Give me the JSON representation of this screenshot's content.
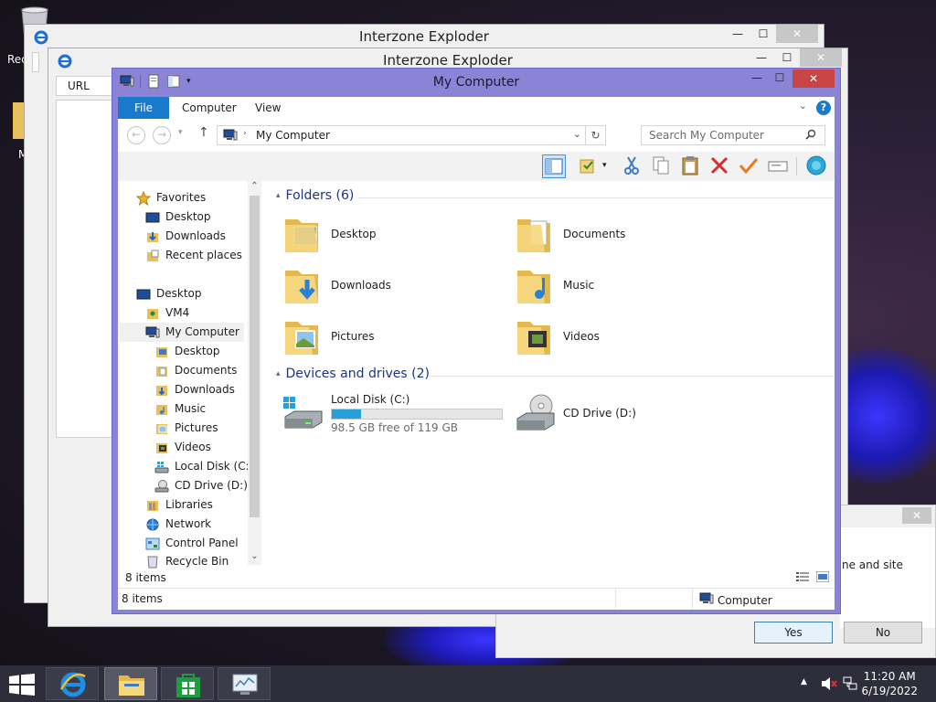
{
  "desktop": {
    "recycle_label_partial": "Rec",
    "my_label_partial": "M"
  },
  "ie_back": {
    "title": "Interzone Exploder"
  },
  "ie_front": {
    "title": "Interzone Exploder",
    "url_label": "URL"
  },
  "explorer": {
    "title": "My Computer",
    "tabs": [
      "File",
      "Computer",
      "View"
    ],
    "address": "My Computer",
    "search_placeholder": "Search My Computer",
    "nav": {
      "favorites": "Favorites",
      "fav_items": [
        "Desktop",
        "Downloads",
        "Recent places"
      ],
      "desktop": "Desktop",
      "vm": "VM4",
      "my_computer": "My Computer",
      "mc_items": [
        "Desktop",
        "Documents",
        "Downloads",
        "Music",
        "Pictures",
        "Videos",
        "Local Disk (C:)",
        "CD Drive (D:)"
      ],
      "libraries": "Libraries",
      "network": "Network",
      "control_panel": "Control Panel",
      "recycle_bin": "Recycle Bin"
    },
    "folders_header": "Folders (6)",
    "folders": [
      "Desktop",
      "Documents",
      "Downloads",
      "Music",
      "Pictures",
      "Videos"
    ],
    "devices_header": "Devices and drives (2)",
    "local_disk": {
      "name": "Local Disk (C:)",
      "free_text": "98.5 GB free of 119 GB",
      "used_fraction": 0.17
    },
    "cd_drive": "CD Drive (D:)",
    "inner_status": "8 items",
    "status_left": "8 items",
    "status_right": "Computer"
  },
  "dialog": {
    "partial_text": "ne and site",
    "yes": "Yes",
    "no": "No"
  },
  "taskbar": {
    "time": "11:20 AM",
    "date": "6/19/2022"
  },
  "colors": {
    "explorer_frame": "#8a83d6",
    "file_tab": "#1979ca",
    "close_red": "#c94545",
    "bar_fill": "#26a0da"
  }
}
